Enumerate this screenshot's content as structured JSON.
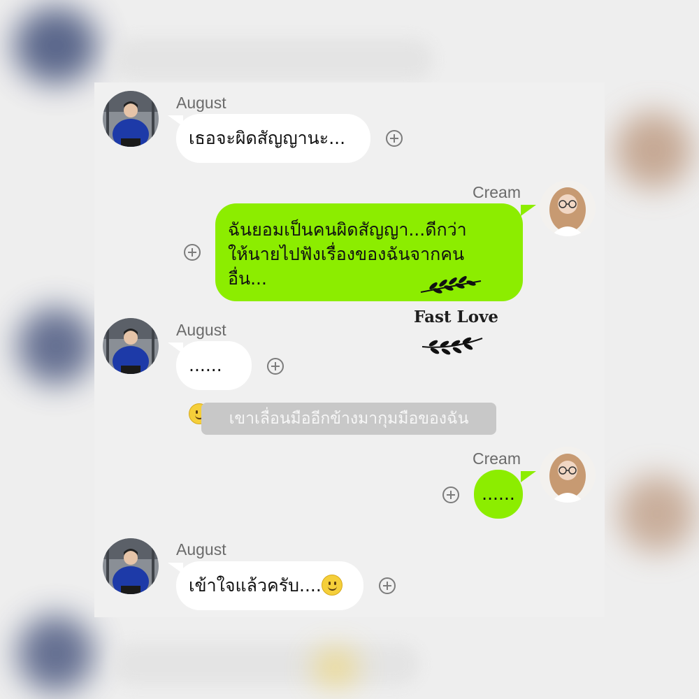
{
  "colors": {
    "outgoing_bubble": "#8ced00",
    "incoming_bubble": "#ffffff",
    "background": "#f0f0f0",
    "narration_bg": "#c8c8c8"
  },
  "messages": [
    {
      "sender": "August",
      "direction": "incoming",
      "text": "เธอจะผิดสัญญานะ..."
    },
    {
      "sender": "Cream",
      "direction": "outgoing",
      "lines": [
        "ฉันยอมเป็นคนผิดสัญญา...ดีกว่า",
        "ให้นายไปฟังเรื่องของฉันจากคน",
        "อื่น..."
      ]
    },
    {
      "sender": "August",
      "direction": "incoming",
      "text": "......",
      "emoji": "slightly-smiling-face"
    },
    {
      "sender": "Cream",
      "direction": "outgoing",
      "text": "......"
    },
    {
      "sender": "August",
      "direction": "incoming",
      "text": "เข้าใจแล้วครับ....",
      "emoji": "slightly-smiling-face"
    }
  ],
  "narration": "เขาเลื่อนมืออีกข้างมากุมมือของฉัน",
  "watermark": "Fast Love"
}
